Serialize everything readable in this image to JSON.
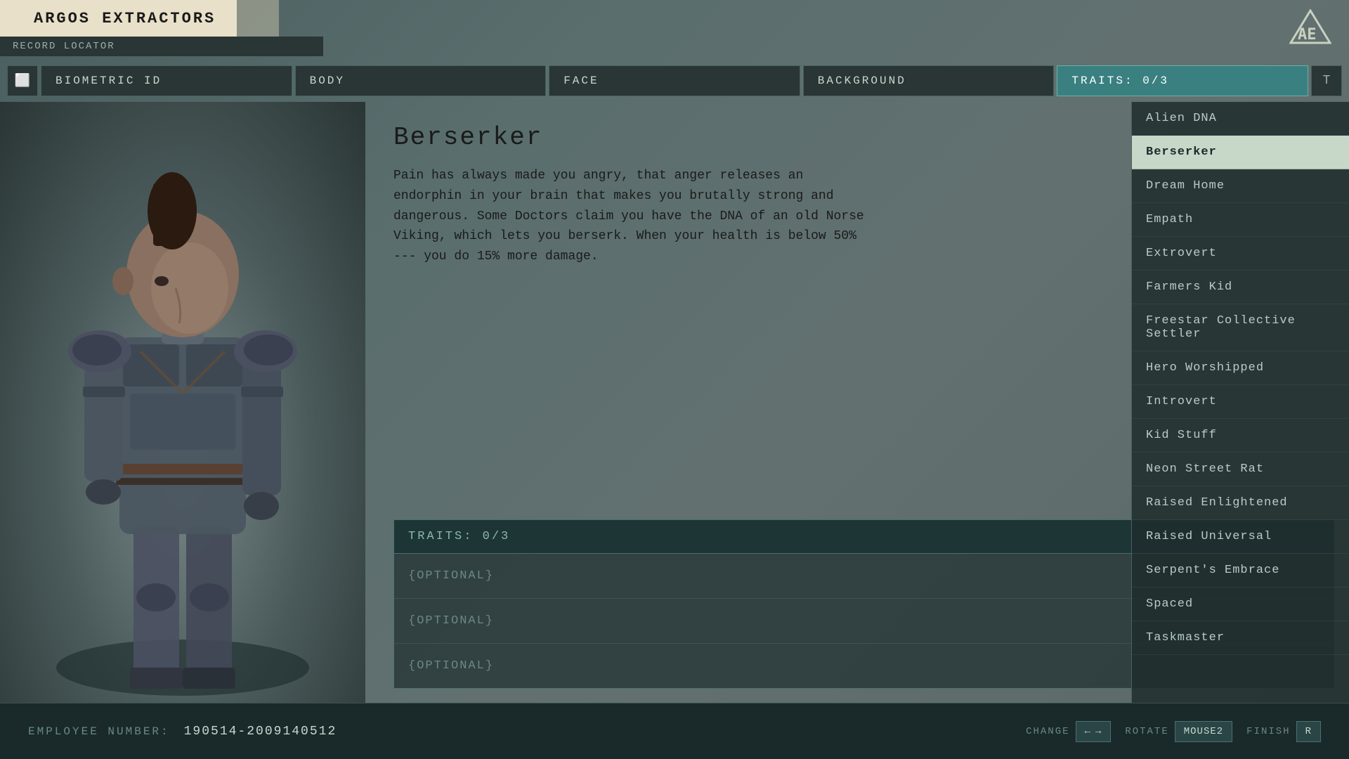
{
  "app": {
    "title": "ARGOS EXTRACTORS",
    "subtitle": "RECORD LOCATOR",
    "logo_text": "AE"
  },
  "nav": {
    "left_btn": "◀",
    "right_btn": "T",
    "tabs": [
      {
        "id": "biometric",
        "label": "BIOMETRIC ID",
        "active": false
      },
      {
        "id": "body",
        "label": "BODY",
        "active": false
      },
      {
        "id": "face",
        "label": "FACE",
        "active": false
      },
      {
        "id": "background",
        "label": "BACKGROUND",
        "active": false
      },
      {
        "id": "traits",
        "label": "TRAITS: 0/3",
        "active": true
      }
    ]
  },
  "selected_trait": {
    "name": "Berserker",
    "description": "Pain has always made you angry, that anger releases an endorphin in your brain that makes you brutally strong and dangerous. Some Doctors claim you have the DNA of an old Norse Viking, which lets you berserk. When your health is below 50% --- you do 15% more damage."
  },
  "traits_slots": {
    "header": "TRAITS: 0/3",
    "slots": [
      {
        "label": "{OPTIONAL}"
      },
      {
        "label": "{OPTIONAL}"
      },
      {
        "label": "{OPTIONAL}"
      }
    ]
  },
  "trait_list": [
    {
      "id": "alien-dna",
      "label": "Alien DNA",
      "selected": false
    },
    {
      "id": "berserker",
      "label": "Berserker",
      "selected": true
    },
    {
      "id": "dream-home",
      "label": "Dream Home",
      "selected": false
    },
    {
      "id": "empath",
      "label": "Empath",
      "selected": false
    },
    {
      "id": "extrovert",
      "label": "Extrovert",
      "selected": false
    },
    {
      "id": "farmers-kid",
      "label": "Farmers Kid",
      "selected": false
    },
    {
      "id": "freestar-collective-settler",
      "label": "Freestar Collective Settler",
      "selected": false
    },
    {
      "id": "hero-worshipped",
      "label": "Hero Worshipped",
      "selected": false
    },
    {
      "id": "introvert",
      "label": "Introvert",
      "selected": false
    },
    {
      "id": "kid-stuff",
      "label": "Kid Stuff",
      "selected": false
    },
    {
      "id": "neon-street-rat",
      "label": "Neon Street Rat",
      "selected": false
    },
    {
      "id": "raised-enlightened",
      "label": "Raised Enlightened",
      "selected": false
    },
    {
      "id": "raised-universal",
      "label": "Raised Universal",
      "selected": false
    },
    {
      "id": "serpents-embrace",
      "label": "Serpent's Embrace",
      "selected": false
    },
    {
      "id": "spaced",
      "label": "Spaced",
      "selected": false
    },
    {
      "id": "taskmaster",
      "label": "Taskmaster",
      "selected": false
    }
  ],
  "bottom": {
    "employee_label": "EMPLOYEE NUMBER:",
    "employee_number": "190514-2009140512",
    "change_label": "CHANGE",
    "change_keys": [
      "←",
      "→"
    ],
    "rotate_label": "ROTATE",
    "rotate_key": "MOUSE2",
    "finish_label": "FINISH",
    "finish_key": "R"
  }
}
